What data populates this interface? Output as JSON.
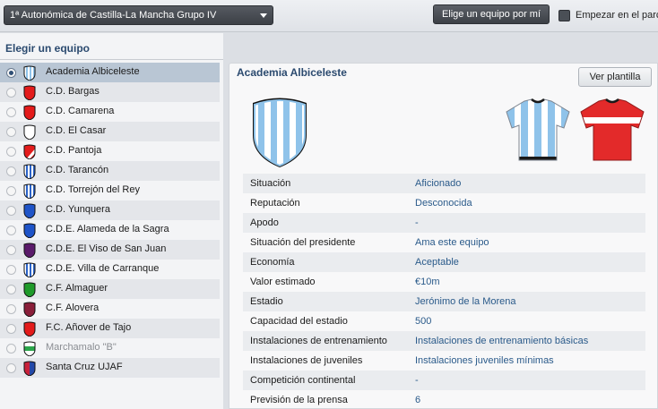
{
  "topbar": {
    "league": "1ª Autonómica de Castilla-La Mancha Grupo IV",
    "pick_button": "Elige un equipo por mí",
    "start_label": "Empezar en el parc"
  },
  "left_panel": {
    "title": "Elegir un equipo",
    "teams": [
      {
        "name": "Academia Albiceleste",
        "crest": "sky-blue-white-stripes",
        "selected": true
      },
      {
        "name": "C.D. Bargas",
        "crest": "red"
      },
      {
        "name": "C.D. Camarena",
        "crest": "red"
      },
      {
        "name": "C.D. El Casar",
        "crest": "white"
      },
      {
        "name": "C.D. Pantoja",
        "crest": "red-white-diagonal"
      },
      {
        "name": "C.D. Tarancón",
        "crest": "blue-white-stripes"
      },
      {
        "name": "C.D. Torrejón del Rey",
        "crest": "blue-white-stripes"
      },
      {
        "name": "C.D. Yunquera",
        "crest": "blue"
      },
      {
        "name": "C.D.E. Alameda de la Sagra",
        "crest": "blue"
      },
      {
        "name": "C.D.E. El Viso de San Juan",
        "crest": "purple"
      },
      {
        "name": "C.D.E. Villa de Carranque",
        "crest": "blue-white-stripes"
      },
      {
        "name": "C.F. Almaguer",
        "crest": "green"
      },
      {
        "name": "C.F. Alovera",
        "crest": "maroon"
      },
      {
        "name": "F.C. Añover de Tajo",
        "crest": "red"
      },
      {
        "name": "Marchamalo \"B\"",
        "crest": "green-white",
        "greyed": true
      },
      {
        "name": "Santa Cruz UJAF",
        "crest": "red-blue"
      }
    ]
  },
  "detail": {
    "title": "Academia Albiceleste",
    "squad_button": "Ver plantilla",
    "rows": [
      {
        "label": "Situación",
        "value": "Aficionado"
      },
      {
        "label": "Reputación",
        "value": "Desconocida"
      },
      {
        "label": "Apodo",
        "value": "-"
      },
      {
        "label": "Situación del presidente",
        "value": "Ama este equipo"
      },
      {
        "label": "Economía",
        "value": "Aceptable"
      },
      {
        "label": "Valor estimado",
        "value": "€10m"
      },
      {
        "label": "Estadio",
        "value": "Jerónimo de la Morena"
      },
      {
        "label": "Capacidad del estadio",
        "value": "500"
      },
      {
        "label": "Instalaciones de entrenamiento",
        "value": "Instalaciones de entrenamiento básicas"
      },
      {
        "label": "Instalaciones de juveniles",
        "value": "Instalaciones juveniles mínimas"
      },
      {
        "label": "Competición continental",
        "value": "-"
      },
      {
        "label": "Previsión de la prensa",
        "value": "6"
      }
    ]
  },
  "colors": {
    "accent_title": "#2b4a6f",
    "value_text": "#2a5a8a",
    "selected_row": "#b9c6d4"
  }
}
